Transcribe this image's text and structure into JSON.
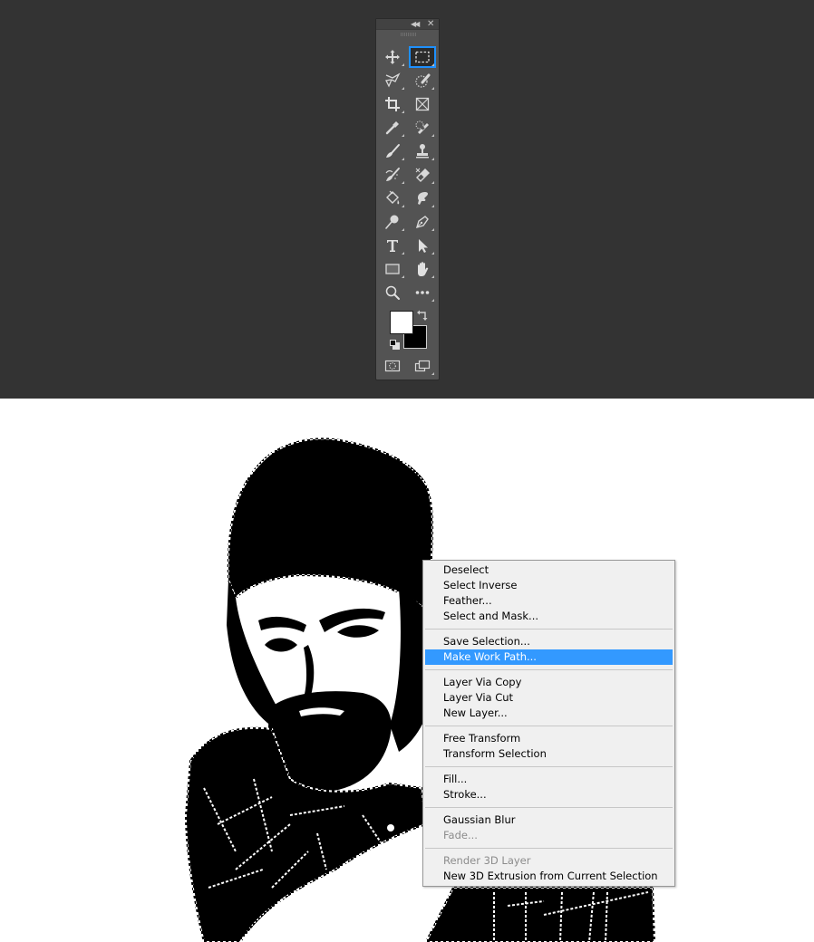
{
  "toolbar": {
    "collapse_icon": "double-chevron-left-icon",
    "close_icon": "close-icon",
    "tools": [
      {
        "name": "move-tool",
        "icon": "move-arrows-icon",
        "active": false,
        "has_submenu": true
      },
      {
        "name": "rectangular-marquee-tool",
        "icon": "dashed-rectangle-icon",
        "active": true,
        "has_submenu": true
      },
      {
        "name": "polygonal-lasso-tool",
        "icon": "lasso-icon",
        "active": false,
        "has_submenu": true
      },
      {
        "name": "quick-selection-tool",
        "icon": "quick-selection-brush-icon",
        "active": false,
        "has_submenu": true
      },
      {
        "name": "crop-tool",
        "icon": "crop-icon",
        "active": false,
        "has_submenu": true
      },
      {
        "name": "frame-tool",
        "icon": "frame-x-icon",
        "active": false,
        "has_submenu": false
      },
      {
        "name": "eyedropper-tool",
        "icon": "eyedropper-icon",
        "active": false,
        "has_submenu": true
      },
      {
        "name": "spot-healing-brush-tool",
        "icon": "bandage-icon",
        "active": false,
        "has_submenu": true
      },
      {
        "name": "brush-tool",
        "icon": "brush-icon",
        "active": false,
        "has_submenu": true
      },
      {
        "name": "clone-stamp-tool",
        "icon": "stamp-icon",
        "active": false,
        "has_submenu": true
      },
      {
        "name": "history-brush-tool",
        "icon": "history-brush-icon",
        "active": false,
        "has_submenu": true
      },
      {
        "name": "eraser-tool",
        "icon": "eraser-icon",
        "active": false,
        "has_submenu": true
      },
      {
        "name": "paint-bucket-tool",
        "icon": "paint-bucket-icon",
        "active": false,
        "has_submenu": true
      },
      {
        "name": "smudge-tool",
        "icon": "smudge-finger-icon",
        "active": false,
        "has_submenu": true
      },
      {
        "name": "dodge-tool",
        "icon": "dodge-icon",
        "active": false,
        "has_submenu": true
      },
      {
        "name": "pen-tool",
        "icon": "pen-nib-icon",
        "active": false,
        "has_submenu": true
      },
      {
        "name": "type-tool",
        "icon": "type-t-icon",
        "active": false,
        "has_submenu": true
      },
      {
        "name": "path-selection-tool",
        "icon": "arrow-cursor-icon",
        "active": false,
        "has_submenu": true
      },
      {
        "name": "rectangle-tool",
        "icon": "rectangle-shape-icon",
        "active": false,
        "has_submenu": true
      },
      {
        "name": "hand-tool",
        "icon": "hand-icon",
        "active": false,
        "has_submenu": true
      },
      {
        "name": "zoom-tool",
        "icon": "magnifier-icon",
        "active": false,
        "has_submenu": false
      },
      {
        "name": "edit-toolbar",
        "icon": "ellipsis-icon",
        "active": false,
        "has_submenu": true
      }
    ],
    "foreground_color": "#ffffff",
    "background_color": "#000000",
    "quick_mask_icon": "quick-mask-icon",
    "screen_mode_icon": "screen-mode-icon"
  },
  "context_menu": {
    "groups": [
      [
        {
          "label": "Deselect",
          "state": "normal"
        },
        {
          "label": "Select Inverse",
          "state": "normal"
        },
        {
          "label": "Feather...",
          "state": "normal"
        },
        {
          "label": "Select and Mask...",
          "state": "normal"
        }
      ],
      [
        {
          "label": "Save Selection...",
          "state": "normal"
        },
        {
          "label": "Make Work Path...",
          "state": "highlighted"
        }
      ],
      [
        {
          "label": "Layer Via Copy",
          "state": "normal"
        },
        {
          "label": "Layer Via Cut",
          "state": "normal"
        },
        {
          "label": "New Layer...",
          "state": "normal"
        }
      ],
      [
        {
          "label": "Free Transform",
          "state": "normal"
        },
        {
          "label": "Transform Selection",
          "state": "normal"
        }
      ],
      [
        {
          "label": "Fill...",
          "state": "normal"
        },
        {
          "label": "Stroke...",
          "state": "normal"
        }
      ],
      [
        {
          "label": "Gaussian Blur",
          "state": "normal"
        },
        {
          "label": "Fade...",
          "state": "disabled"
        }
      ],
      [
        {
          "label": "Render 3D Layer",
          "state": "disabled"
        },
        {
          "label": "New 3D Extrusion from Current Selection",
          "state": "normal"
        }
      ]
    ]
  },
  "colors": {
    "workspace": "#333333",
    "toolbar": "#535353",
    "active_tool_outline": "#1e90ff",
    "menu_background": "#f0f0f0",
    "menu_highlight": "#3399ff"
  }
}
